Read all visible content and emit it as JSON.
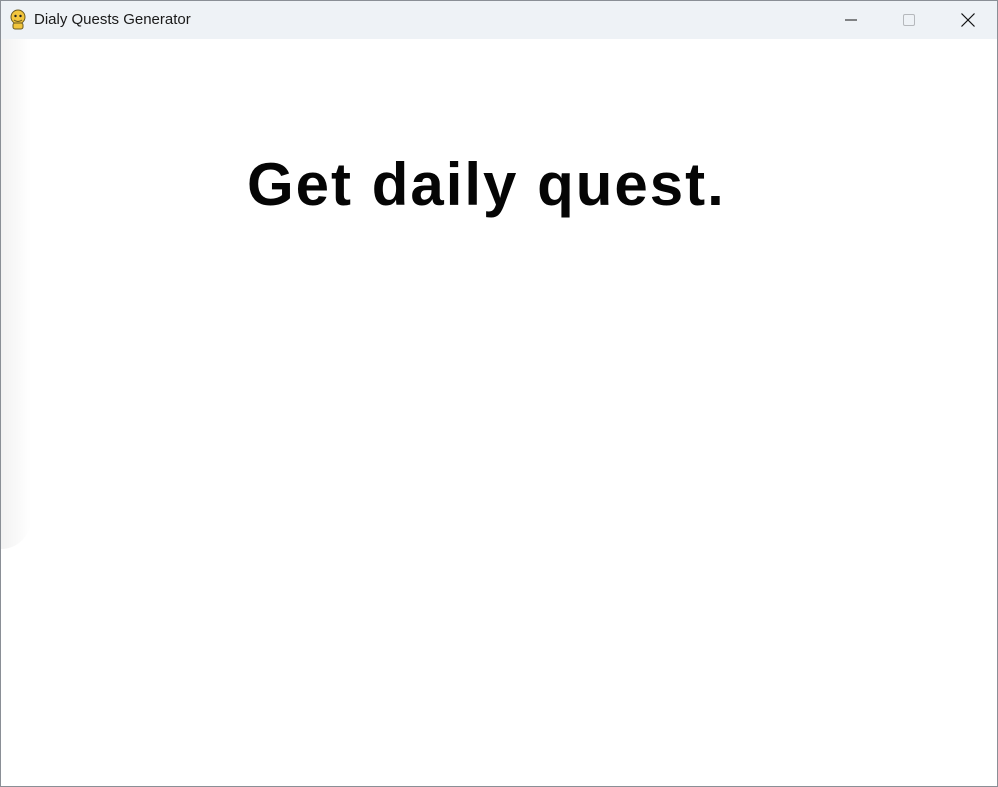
{
  "window": {
    "title": "Dialy Quests Generator",
    "icon": "python-snake-icon"
  },
  "controls": {
    "minimize": "minimize-icon",
    "maximize": "maximize-icon",
    "close": "close-icon"
  },
  "main": {
    "heading": "Get daily quest."
  }
}
